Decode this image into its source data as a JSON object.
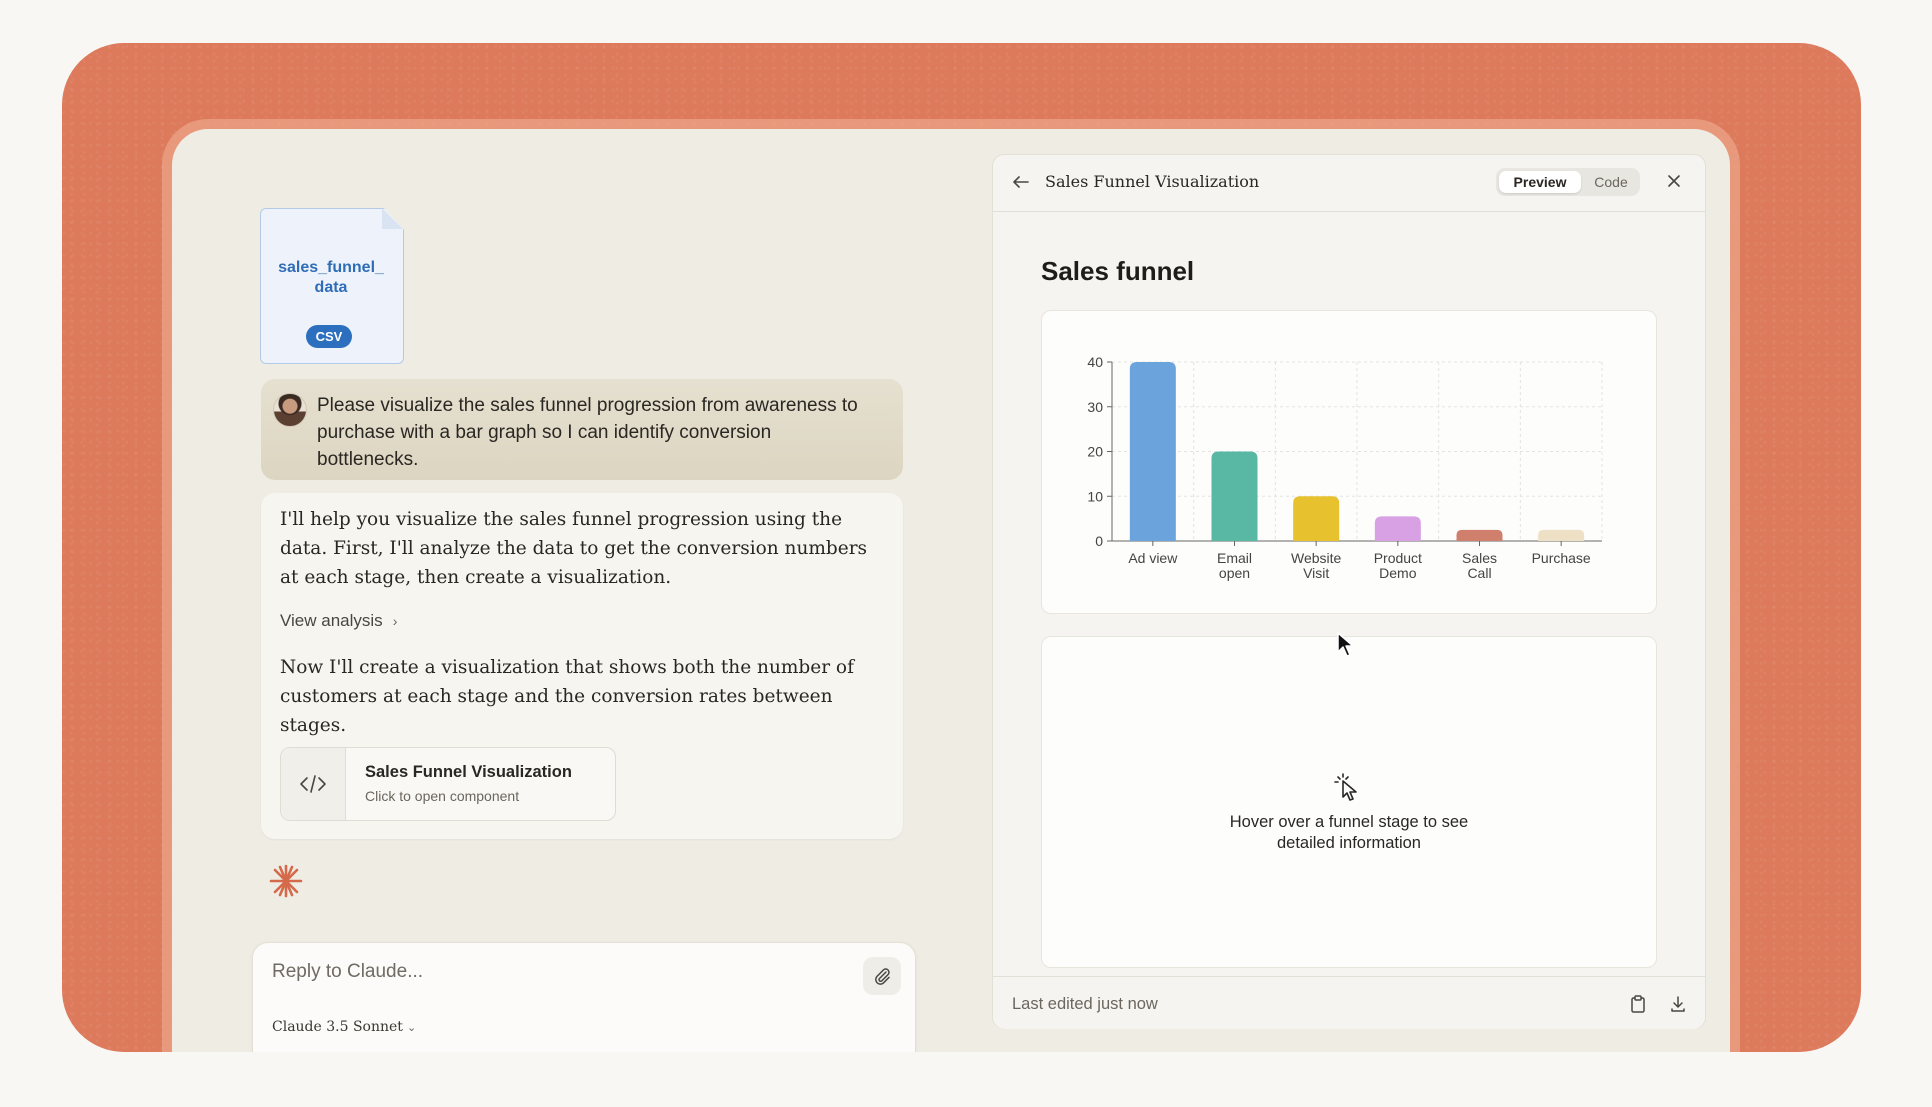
{
  "file": {
    "name": "sales_funnel_\ndata",
    "type": "CSV"
  },
  "user_message": "Please visualize the sales funnel progression from awareness to purchase with a bar graph so I can identify conversion bottlenecks.",
  "assistant": {
    "para1": "I'll help you visualize the sales funnel progression using the data. First, I'll analyze the data to get the conversion numbers at each stage, then create a visualization.",
    "view_analysis": "View analysis",
    "para2": "Now I'll create a visualization that shows both the number of customers at each stage and the conversion rates between stages.",
    "artifact_title": "Sales Funnel Visualization",
    "artifact_sub": "Click to open component"
  },
  "composer": {
    "placeholder": "Reply to Claude...",
    "model": "Claude 3.5 Sonnet"
  },
  "panel": {
    "title": "Sales Funnel Visualization",
    "tab_preview": "Preview",
    "tab_code": "Code",
    "heading": "Sales funnel",
    "info_line1": "Hover over a funnel stage to see",
    "info_line2": "detailed information",
    "footer": "Last edited just now"
  },
  "colors": {
    "brand": "#dd7a5c",
    "bars": [
      "#6ba3dc",
      "#58b8a4",
      "#e8c12e",
      "#d8a1e4",
      "#cf7f6c",
      "#ede0c4"
    ]
  },
  "chart_data": {
    "type": "bar",
    "categories": [
      "Ad view",
      "Email open",
      "Website Visit",
      "Product Demo",
      "Sales Call",
      "Purchase"
    ],
    "category_lines": [
      [
        "Ad view"
      ],
      [
        "Email",
        "open"
      ],
      [
        "Website",
        "Visit"
      ],
      [
        "Product",
        "Demo"
      ],
      [
        "Sales",
        "Call"
      ],
      [
        "Purchase"
      ]
    ],
    "values": [
      40,
      20,
      10,
      5.5,
      2.5,
      2.5
    ],
    "ylim": [
      0,
      40
    ],
    "yticks": [
      0,
      10,
      20,
      30,
      40
    ],
    "grid": true,
    "title": "Sales funnel"
  }
}
